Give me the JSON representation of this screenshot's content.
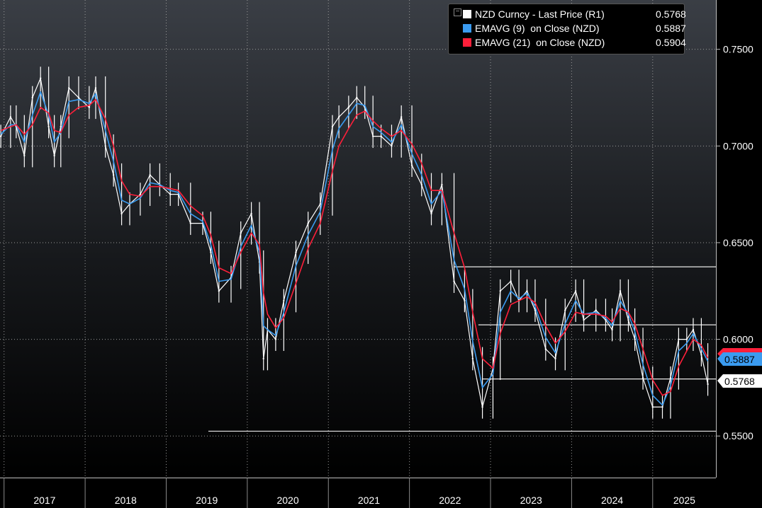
{
  "legend": {
    "rows": [
      {
        "label": "NZD Curncy - Last Price (R1)",
        "value": "0.5768",
        "color": "#ffffff"
      },
      {
        "label": "EMAVG (9)  on Close (NZD)",
        "value": "0.5887",
        "color": "#3a9bf0"
      },
      {
        "label": "EMAVG (21)  on Close (NZD)",
        "value": "0.5904",
        "color": "#ff1f3a"
      }
    ]
  },
  "price_tags": {
    "ema21": "",
    "ema9": "0.5887",
    "last": "0.5768"
  },
  "chart_data": {
    "type": "line",
    "title": "",
    "x_labels": [
      "2017",
      "2018",
      "2019",
      "2020",
      "2021",
      "2022",
      "2023",
      "2024",
      "2025"
    ],
    "ylim": [
      0.5285,
      0.7755
    ],
    "y_ticks": [
      0.55,
      0.6,
      0.65,
      0.7,
      0.75
    ],
    "y_tick_labels": [
      "0.5500",
      "0.6000",
      "0.6500",
      "0.7000",
      "0.7500"
    ],
    "x_range": [
      2016.95,
      2025.78
    ],
    "grid": true,
    "legend_position": "top-right",
    "series": [
      {
        "name": "NZD Curncy - Last Price (R1)",
        "color": "#ffffff",
        "x": [
          2016.96,
          2017.08,
          2017.15,
          2017.25,
          2017.35,
          2017.45,
          2017.55,
          2017.62,
          2017.7,
          2017.8,
          2017.92,
          2018.05,
          2018.13,
          2018.25,
          2018.35,
          2018.45,
          2018.55,
          2018.68,
          2018.8,
          2018.92,
          2019.05,
          2019.15,
          2019.3,
          2019.45,
          2019.55,
          2019.65,
          2019.8,
          2019.92,
          2020.05,
          2020.15,
          2020.2,
          2020.25,
          2020.35,
          2020.45,
          2020.6,
          2020.75,
          2020.9,
          2021.05,
          2021.13,
          2021.25,
          2021.35,
          2021.45,
          2021.55,
          2021.65,
          2021.78,
          2021.9,
          2022.03,
          2022.15,
          2022.27,
          2022.4,
          2022.55,
          2022.68,
          2022.78,
          2022.9,
          2023.03,
          2023.12,
          2023.25,
          2023.35,
          2023.45,
          2023.55,
          2023.68,
          2023.8,
          2023.92,
          2024.05,
          2024.15,
          2024.3,
          2024.42,
          2024.5,
          2024.6,
          2024.7,
          2024.78,
          2024.88,
          2025.0,
          2025.12,
          2025.22,
          2025.32,
          2025.42,
          2025.5,
          2025.6,
          2025.68
        ],
        "y": [
          0.705,
          0.715,
          0.71,
          0.695,
          0.725,
          0.735,
          0.71,
          0.695,
          0.71,
          0.73,
          0.725,
          0.72,
          0.73,
          0.7,
          0.685,
          0.665,
          0.67,
          0.675,
          0.685,
          0.68,
          0.675,
          0.675,
          0.66,
          0.66,
          0.645,
          0.625,
          0.632,
          0.655,
          0.665,
          0.64,
          0.59,
          0.605,
          0.6,
          0.62,
          0.645,
          0.66,
          0.67,
          0.71,
          0.715,
          0.72,
          0.725,
          0.72,
          0.705,
          0.705,
          0.7,
          0.715,
          0.69,
          0.68,
          0.665,
          0.68,
          0.63,
          0.62,
          0.59,
          0.565,
          0.585,
          0.625,
          0.63,
          0.62,
          0.625,
          0.615,
          0.595,
          0.59,
          0.615,
          0.625,
          0.61,
          0.615,
          0.61,
          0.605,
          0.625,
          0.61,
          0.6,
          0.58,
          0.565,
          0.565,
          0.58,
          0.6,
          0.6,
          0.605,
          0.592,
          0.5768
        ]
      },
      {
        "name": "EMAVG (9)  on Close (NZD)",
        "color": "#3a9bf0",
        "x": [
          2016.96,
          2017.08,
          2017.15,
          2017.25,
          2017.35,
          2017.45,
          2017.55,
          2017.62,
          2017.7,
          2017.8,
          2017.92,
          2018.05,
          2018.13,
          2018.25,
          2018.35,
          2018.45,
          2018.55,
          2018.68,
          2018.8,
          2018.92,
          2019.05,
          2019.15,
          2019.3,
          2019.45,
          2019.55,
          2019.65,
          2019.8,
          2019.92,
          2020.05,
          2020.15,
          2020.2,
          2020.25,
          2020.35,
          2020.45,
          2020.6,
          2020.75,
          2020.9,
          2021.05,
          2021.13,
          2021.25,
          2021.35,
          2021.45,
          2021.55,
          2021.65,
          2021.78,
          2021.9,
          2022.03,
          2022.15,
          2022.27,
          2022.4,
          2022.55,
          2022.68,
          2022.78,
          2022.9,
          2023.03,
          2023.12,
          2023.25,
          2023.35,
          2023.45,
          2023.55,
          2023.68,
          2023.8,
          2023.92,
          2024.05,
          2024.15,
          2024.3,
          2024.42,
          2024.5,
          2024.6,
          2024.7,
          2024.78,
          2024.88,
          2025.0,
          2025.12,
          2025.22,
          2025.32,
          2025.42,
          2025.5,
          2025.6,
          2025.68
        ],
        "y": [
          0.706,
          0.711,
          0.711,
          0.702,
          0.716,
          0.728,
          0.716,
          0.702,
          0.707,
          0.723,
          0.724,
          0.722,
          0.727,
          0.708,
          0.692,
          0.672,
          0.67,
          0.673,
          0.681,
          0.68,
          0.677,
          0.676,
          0.665,
          0.661,
          0.649,
          0.63,
          0.631,
          0.648,
          0.659,
          0.645,
          0.607,
          0.605,
          0.602,
          0.614,
          0.638,
          0.654,
          0.666,
          0.698,
          0.709,
          0.716,
          0.722,
          0.721,
          0.71,
          0.707,
          0.702,
          0.711,
          0.696,
          0.685,
          0.67,
          0.677,
          0.641,
          0.626,
          0.599,
          0.575,
          0.582,
          0.614,
          0.625,
          0.621,
          0.624,
          0.617,
          0.601,
          0.593,
          0.608,
          0.62,
          0.613,
          0.614,
          0.611,
          0.607,
          0.62,
          0.613,
          0.604,
          0.587,
          0.571,
          0.566,
          0.576,
          0.594,
          0.598,
          0.603,
          0.595,
          0.5887
        ]
      },
      {
        "name": "EMAVG (21)  on Close (NZD)",
        "color": "#ff1f3a",
        "x": [
          2016.96,
          2017.08,
          2017.15,
          2017.25,
          2017.35,
          2017.45,
          2017.55,
          2017.62,
          2017.7,
          2017.8,
          2017.92,
          2018.05,
          2018.13,
          2018.25,
          2018.35,
          2018.45,
          2018.55,
          2018.68,
          2018.8,
          2018.92,
          2019.05,
          2019.15,
          2019.3,
          2019.45,
          2019.55,
          2019.65,
          2019.8,
          2019.92,
          2020.05,
          2020.15,
          2020.2,
          2020.25,
          2020.35,
          2020.45,
          2020.6,
          2020.75,
          2020.9,
          2021.05,
          2021.13,
          2021.25,
          2021.35,
          2021.45,
          2021.55,
          2021.65,
          2021.78,
          2021.9,
          2022.03,
          2022.15,
          2022.27,
          2022.4,
          2022.55,
          2022.68,
          2022.78,
          2022.9,
          2023.03,
          2023.12,
          2023.25,
          2023.35,
          2023.45,
          2023.55,
          2023.68,
          2023.8,
          2023.92,
          2024.05,
          2024.15,
          2024.3,
          2024.42,
          2024.5,
          2024.6,
          2024.7,
          2024.78,
          2024.88,
          2025.0,
          2025.12,
          2025.22,
          2025.32,
          2025.42,
          2025.5,
          2025.6,
          2025.68
        ],
        "y": [
          0.708,
          0.71,
          0.711,
          0.706,
          0.711,
          0.72,
          0.717,
          0.708,
          0.707,
          0.716,
          0.72,
          0.721,
          0.724,
          0.714,
          0.7,
          0.682,
          0.675,
          0.674,
          0.679,
          0.679,
          0.678,
          0.677,
          0.669,
          0.664,
          0.654,
          0.637,
          0.634,
          0.645,
          0.655,
          0.649,
          0.624,
          0.613,
          0.606,
          0.611,
          0.629,
          0.647,
          0.66,
          0.687,
          0.7,
          0.709,
          0.716,
          0.718,
          0.713,
          0.709,
          0.705,
          0.708,
          0.701,
          0.691,
          0.677,
          0.677,
          0.655,
          0.637,
          0.614,
          0.59,
          0.585,
          0.603,
          0.618,
          0.62,
          0.622,
          0.619,
          0.607,
          0.598,
          0.604,
          0.614,
          0.613,
          0.613,
          0.612,
          0.609,
          0.616,
          0.614,
          0.608,
          0.595,
          0.579,
          0.571,
          0.573,
          0.586,
          0.594,
          0.6,
          0.597,
          0.5904
        ]
      }
    ],
    "horizontal_levels": [
      {
        "y": 0.5525,
        "x_start": 2019.52,
        "x_end": 2025.78
      },
      {
        "y": 0.5795,
        "x_start": 2022.9,
        "x_end": 2025.78
      },
      {
        "y": 0.6075,
        "x_start": 2022.85,
        "x_end": 2025.78
      },
      {
        "y": 0.6375,
        "x_start": 2022.55,
        "x_end": 2025.78
      }
    ]
  }
}
